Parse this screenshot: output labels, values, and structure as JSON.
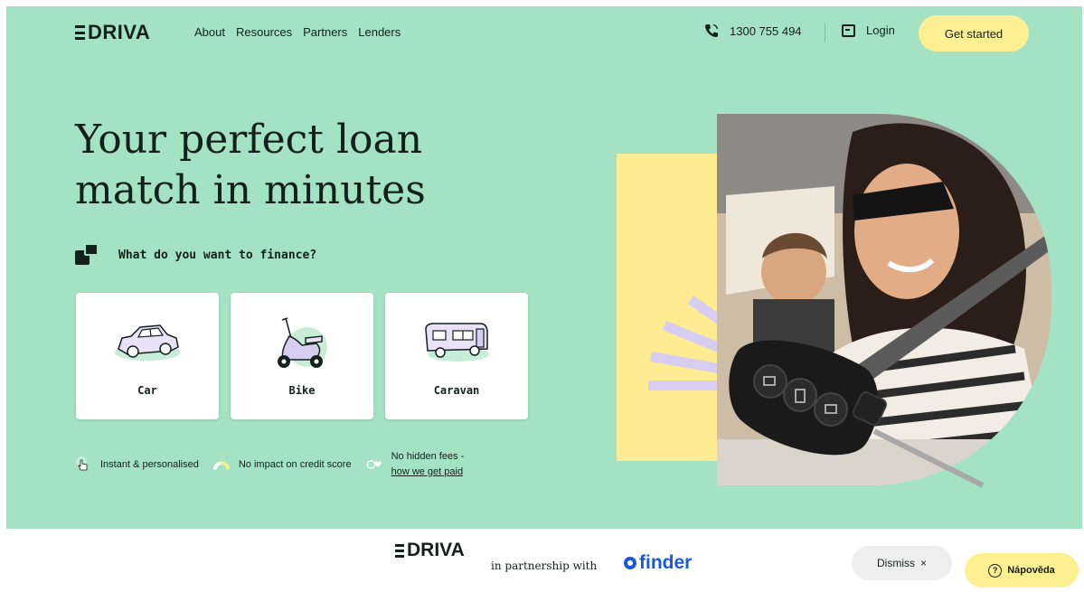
{
  "header": {
    "logo_text": "DRIVA",
    "nav": [
      "About",
      "Resources",
      "Partners",
      "Lenders"
    ],
    "phone": "1300 755 494",
    "login_label": "Login",
    "cta_label": "Get started"
  },
  "hero": {
    "headline_line1": "Your perfect loan",
    "headline_line2": "match in minutes",
    "question": "What do you want to finance?",
    "cards": [
      {
        "label": "Car",
        "icon": "car-icon"
      },
      {
        "label": "Bike",
        "icon": "scooter-icon"
      },
      {
        "label": "Caravan",
        "icon": "caravan-icon"
      }
    ],
    "features": {
      "f1": "Instant & personalised",
      "f2": "No impact on credit score",
      "f3_line1": "No hidden fees -",
      "f3_link": "how we get paid"
    }
  },
  "footer": {
    "logo_text": "DRIVA",
    "partnership_text": "in partnership with",
    "partner_name": "finder",
    "dismiss_label": "Dismiss",
    "dismiss_icon": "×",
    "help_label": "Nápověda",
    "help_icon": "?"
  },
  "colors": {
    "hero_bg": "#a3e2c2",
    "accent_yellow": "#fdf092",
    "text_dark": "#14201b",
    "finder_blue": "#1a5ad6",
    "lavender": "#d7cdf0"
  }
}
